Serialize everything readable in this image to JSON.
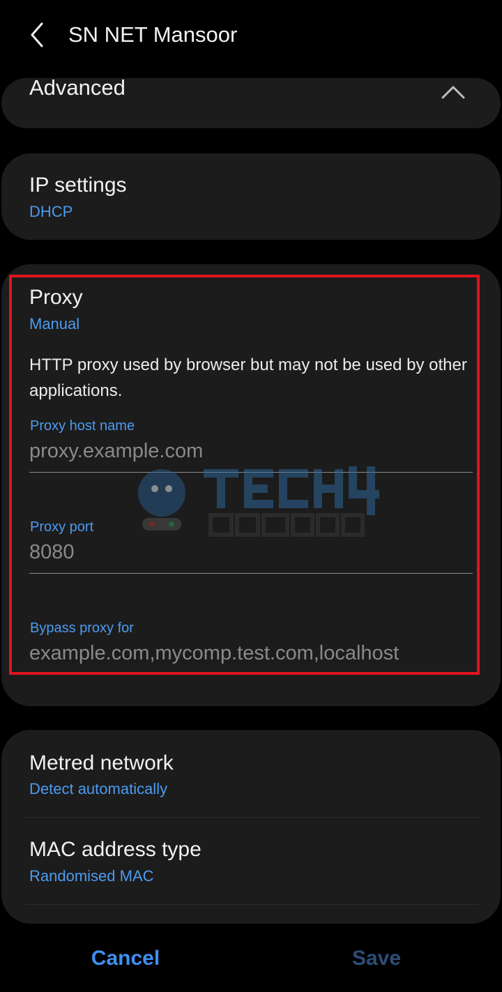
{
  "header": {
    "title": "SN NET Mansoor"
  },
  "advanced": {
    "label": "Advanced"
  },
  "ip_settings": {
    "title": "IP settings",
    "value": "DHCP"
  },
  "proxy": {
    "title": "Proxy",
    "value": "Manual",
    "description": "HTTP proxy used by browser but may not be used by other applications.",
    "host": {
      "label": "Proxy host name",
      "placeholder": "proxy.example.com",
      "value": ""
    },
    "port": {
      "label": "Proxy port",
      "placeholder": "8080",
      "value": ""
    },
    "bypass": {
      "label": "Bypass proxy for",
      "placeholder": "example.com,mycomp.test.com,localhost",
      "value": ""
    }
  },
  "metered": {
    "title": "Metred network",
    "value": "Detect automatically"
  },
  "mac": {
    "title": "MAC address type",
    "value": "Randomised MAC"
  },
  "actions": {
    "cancel": "Cancel",
    "save": "Save"
  },
  "colors": {
    "accent": "#4c9bf0",
    "highlight": "#e0131e",
    "card": "#1c1c1c",
    "save_disabled": "#2c4d78"
  },
  "icons": {
    "back": "chevron-left-icon",
    "collapse": "chevron-up-icon",
    "watermark": "tech4gamers-logo"
  }
}
